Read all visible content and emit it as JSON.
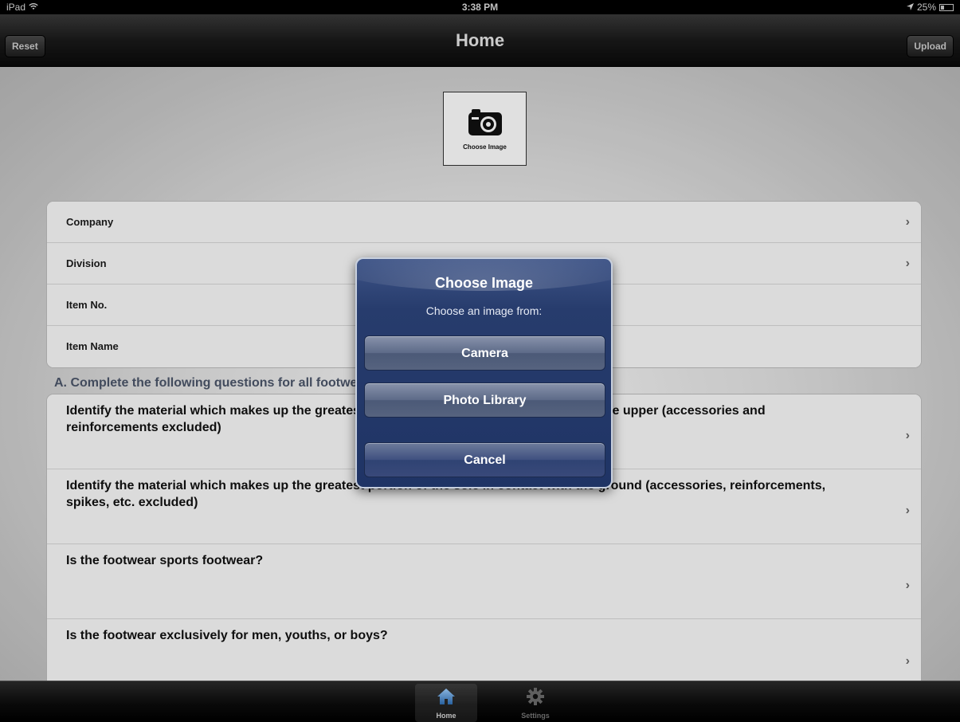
{
  "status_bar": {
    "device": "iPad",
    "time": "3:38 PM",
    "battery": "25%"
  },
  "nav_bar": {
    "title": "Home",
    "left_button": "Reset",
    "right_button": "Upload"
  },
  "choose_image": {
    "label": "Choose Image",
    "icon": "camera-icon"
  },
  "info_rows": [
    {
      "label": "Company",
      "has_chevron": true
    },
    {
      "label": "Division",
      "has_chevron": true
    },
    {
      "label": "Item No.",
      "has_chevron": false
    },
    {
      "label": "Item Name",
      "has_chevron": false
    }
  ],
  "section_header": "A. Complete the following questions for all footwear",
  "questions": [
    {
      "label": "Identify the material which makes up the greatest portion of the external surface area of the upper (accessories and reinforcements excluded)"
    },
    {
      "label": "Identify the material which makes up the greatest portion of the sole in contact with the ground (accessories, reinforcements, spikes, etc. excluded)"
    },
    {
      "label": "Is the footwear sports footwear?"
    },
    {
      "label": "Is the footwear exclusively for men, youths, or boys?"
    }
  ],
  "alert": {
    "title": "Choose Image",
    "message": "Choose an image from:",
    "buttons": [
      "Camera",
      "Photo Library",
      "Cancel"
    ]
  },
  "tab_bar": {
    "tabs": [
      {
        "label": "Home",
        "icon": "home-icon",
        "selected": true
      },
      {
        "label": "Settings",
        "icon": "gear-icon",
        "selected": false
      }
    ]
  },
  "colors": {
    "alert_background": "#273c6d",
    "selected_tab_icon": "#6fa8dc",
    "nav_bar": "#1a1a1a"
  }
}
